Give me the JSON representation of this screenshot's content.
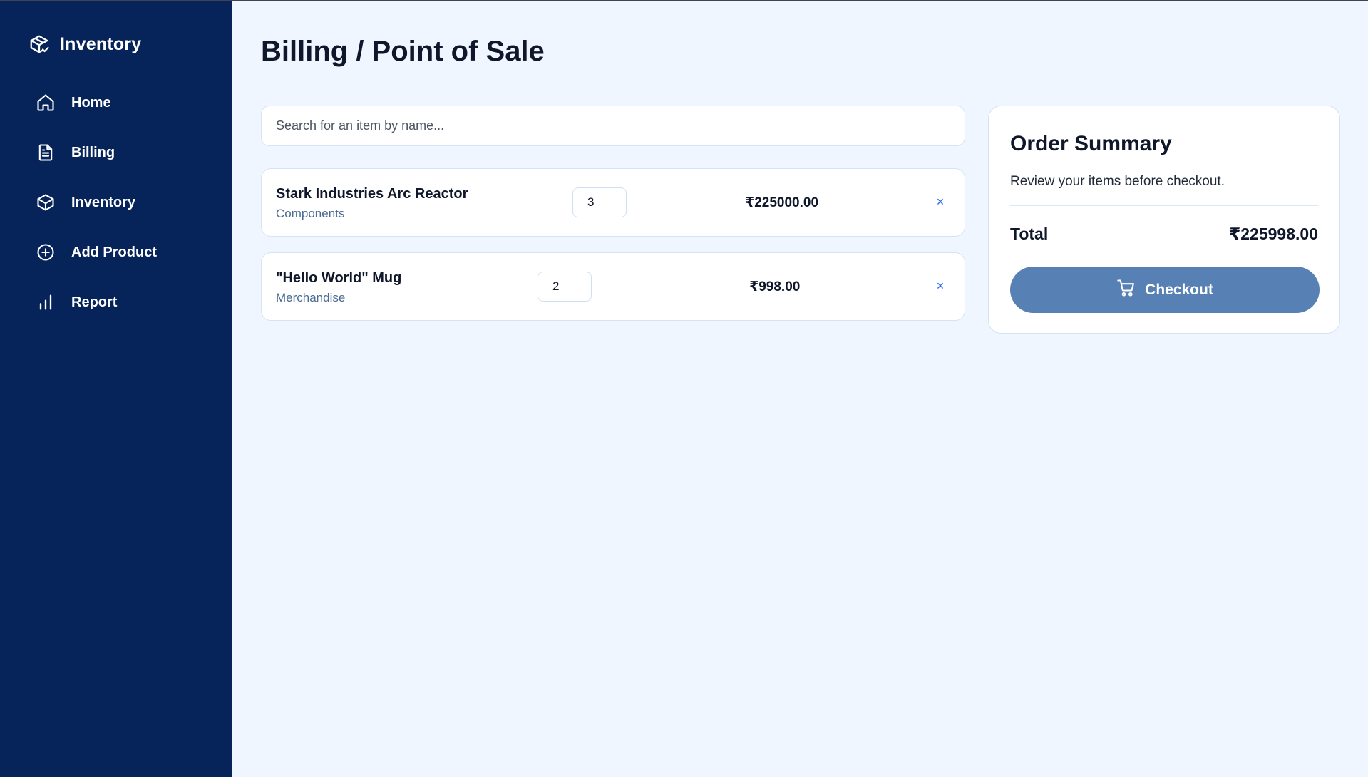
{
  "sidebar": {
    "brand": "Inventory",
    "items": [
      {
        "label": "Home",
        "icon": "home-icon"
      },
      {
        "label": "Billing",
        "icon": "document-icon"
      },
      {
        "label": "Inventory",
        "icon": "box-icon"
      },
      {
        "label": "Add Product",
        "icon": "plus-circle-icon"
      },
      {
        "label": "Report",
        "icon": "bar-chart-icon"
      }
    ]
  },
  "main": {
    "title": "Billing / Point of Sale",
    "search": {
      "placeholder": "Search for an item by name...",
      "value": ""
    },
    "cart": [
      {
        "name": "Stark Industries Arc Reactor",
        "category": "Components",
        "quantity": "3",
        "price": "₹225000.00"
      },
      {
        "name": "\"Hello World\" Mug",
        "category": "Merchandise",
        "quantity": "2",
        "price": "₹998.00"
      }
    ],
    "remove_glyph": "×"
  },
  "summary": {
    "title": "Order Summary",
    "subtitle": "Review your items before checkout.",
    "total_label": "Total",
    "total_value": "₹225998.00",
    "checkout_label": "Checkout",
    "checkout_icon": "cart-icon"
  },
  "colors": {
    "sidebar_bg": "#06245a",
    "page_bg": "#eff6ff",
    "checkout_bg": "#5781b5",
    "category_text": "#4b6b91",
    "remove_icon": "#2563eb"
  }
}
